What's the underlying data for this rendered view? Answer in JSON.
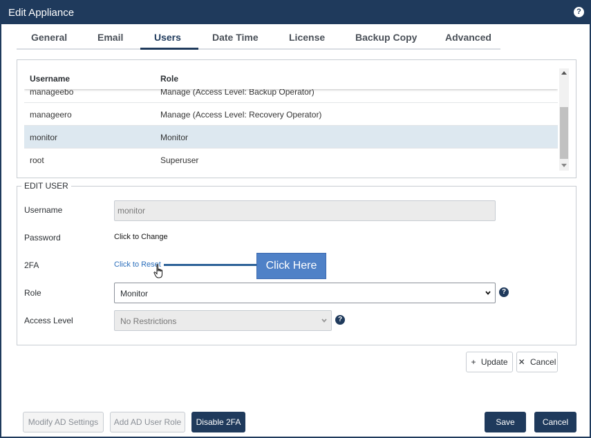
{
  "dialog": {
    "title": "Edit Appliance",
    "help_icon": "?"
  },
  "tabs": [
    {
      "label": "General"
    },
    {
      "label": "Email"
    },
    {
      "label": "Users"
    },
    {
      "label": "Date Time"
    },
    {
      "label": "License"
    },
    {
      "label": "Backup Copy"
    },
    {
      "label": "Advanced"
    }
  ],
  "active_tab": "Users",
  "users_table": {
    "headers": {
      "username": "Username",
      "role": "Role"
    },
    "rows": [
      {
        "username": "manageebo",
        "role": "Manage (Access Level: Backup Operator)"
      },
      {
        "username": "manageero",
        "role": "Manage (Access Level: Recovery Operator)"
      },
      {
        "username": "monitor",
        "role": "Monitor"
      },
      {
        "username": "root",
        "role": "Superuser"
      }
    ],
    "selected_username": "monitor"
  },
  "edit_user": {
    "legend": "EDIT USER",
    "username_label": "Username",
    "username_value": "monitor",
    "password_label": "Password",
    "password_link": "Click to Change",
    "twofa_label": "2FA",
    "twofa_link": "Click to Reset",
    "role_label": "Role",
    "role_value": "Monitor",
    "access_label": "Access Level",
    "access_value": "No Restrictions",
    "help_icon": "?"
  },
  "callout": {
    "text": "Click Here"
  },
  "actions": {
    "update": "Update",
    "update_icon": "+",
    "cancel": "Cancel",
    "cancel_icon": "✕"
  },
  "footer": {
    "modify_ad": "Modify AD Settings",
    "add_ad_role": "Add AD User Role",
    "disable_2fa": "Disable 2FA",
    "save": "Save",
    "cancel": "Cancel"
  },
  "colors": {
    "primary": "#1f3a5c",
    "link": "#2a6ebb",
    "callout": "#4f81c7",
    "selected_row": "#dde8f0"
  }
}
